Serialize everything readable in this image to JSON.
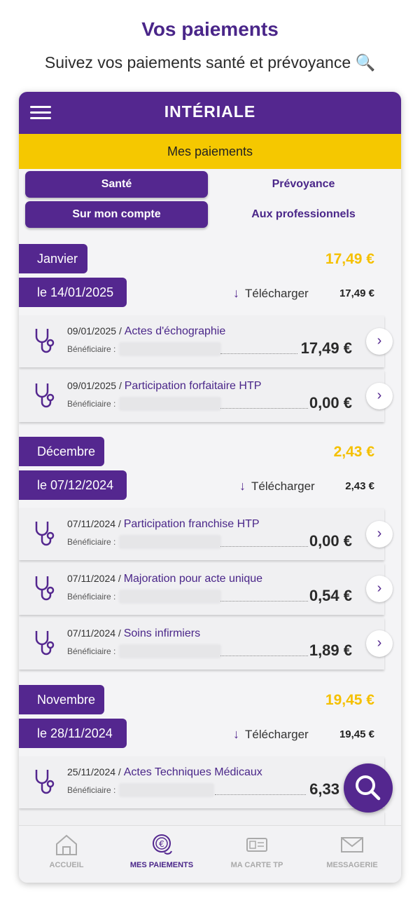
{
  "promo": {
    "title": "Vos paiements",
    "subtitle": "Suivez vos paiements santé et prévoyance 🔍"
  },
  "header": {
    "brand": "INTÉRIALE",
    "menu_icon": "hamburger-icon"
  },
  "banner": {
    "label": "Mes paiements"
  },
  "tabs": {
    "row1": {
      "sante": "Santé",
      "prevoyance": "Prévoyance",
      "active": "Santé"
    },
    "row2": {
      "compte": "Sur mon compte",
      "pros": "Aux professionnels",
      "active": "Sur mon compte"
    }
  },
  "colors": {
    "primary": "#54278f",
    "accent_yellow": "#f5c800",
    "total_yellow": "#f5c000"
  },
  "groups": [
    {
      "month": "Janvier",
      "total": "17,49 €",
      "date": "le 14/01/2025",
      "download": "Télécharger",
      "date_amount": "17,49 €",
      "items": [
        {
          "date": "09/01/2025",
          "act": "Actes d'échographie",
          "beneficiary_label": "Bénéficiaire :",
          "amount": "17,49 €"
        },
        {
          "date": "09/01/2025",
          "act": "Participation forfaitaire HTP",
          "beneficiary_label": "Bénéficiaire :",
          "amount": "0,00 €"
        }
      ]
    },
    {
      "month": "Décembre",
      "total": "2,43 €",
      "date": "le 07/12/2024",
      "download": "Télécharger",
      "date_amount": "2,43 €",
      "items": [
        {
          "date": "07/11/2024",
          "act": "Participation franchise HTP",
          "beneficiary_label": "Bénéficiaire :",
          "amount": "0,00 €"
        },
        {
          "date": "07/11/2024",
          "act": "Majoration pour acte unique",
          "beneficiary_label": "Bénéficiaire :",
          "amount": "0,54 €"
        },
        {
          "date": "07/11/2024",
          "act": "Soins infirmiers",
          "beneficiary_label": "Bénéficiaire :",
          "amount": "1,89 €"
        }
      ]
    },
    {
      "month": "Novembre",
      "total": "19,45 €",
      "date": "le 28/11/2024",
      "download": "Télécharger",
      "date_amount": "19,45 €",
      "items": [
        {
          "date": "25/11/2024",
          "act": "Actes Techniques Médicaux",
          "beneficiary_label": "Bénéficiaire :",
          "amount": "6,33"
        }
      ]
    }
  ],
  "fab": {
    "icon": "search-icon"
  },
  "bottom_nav": [
    {
      "label": "ACCUEIL",
      "icon": "home-icon"
    },
    {
      "label": "MES PAIEMENTS",
      "icon": "euro-coin-icon",
      "active": true
    },
    {
      "label": "MA CARTE TP",
      "icon": "card-icon"
    },
    {
      "label": "MESSAGERIE",
      "icon": "envelope-icon"
    }
  ]
}
